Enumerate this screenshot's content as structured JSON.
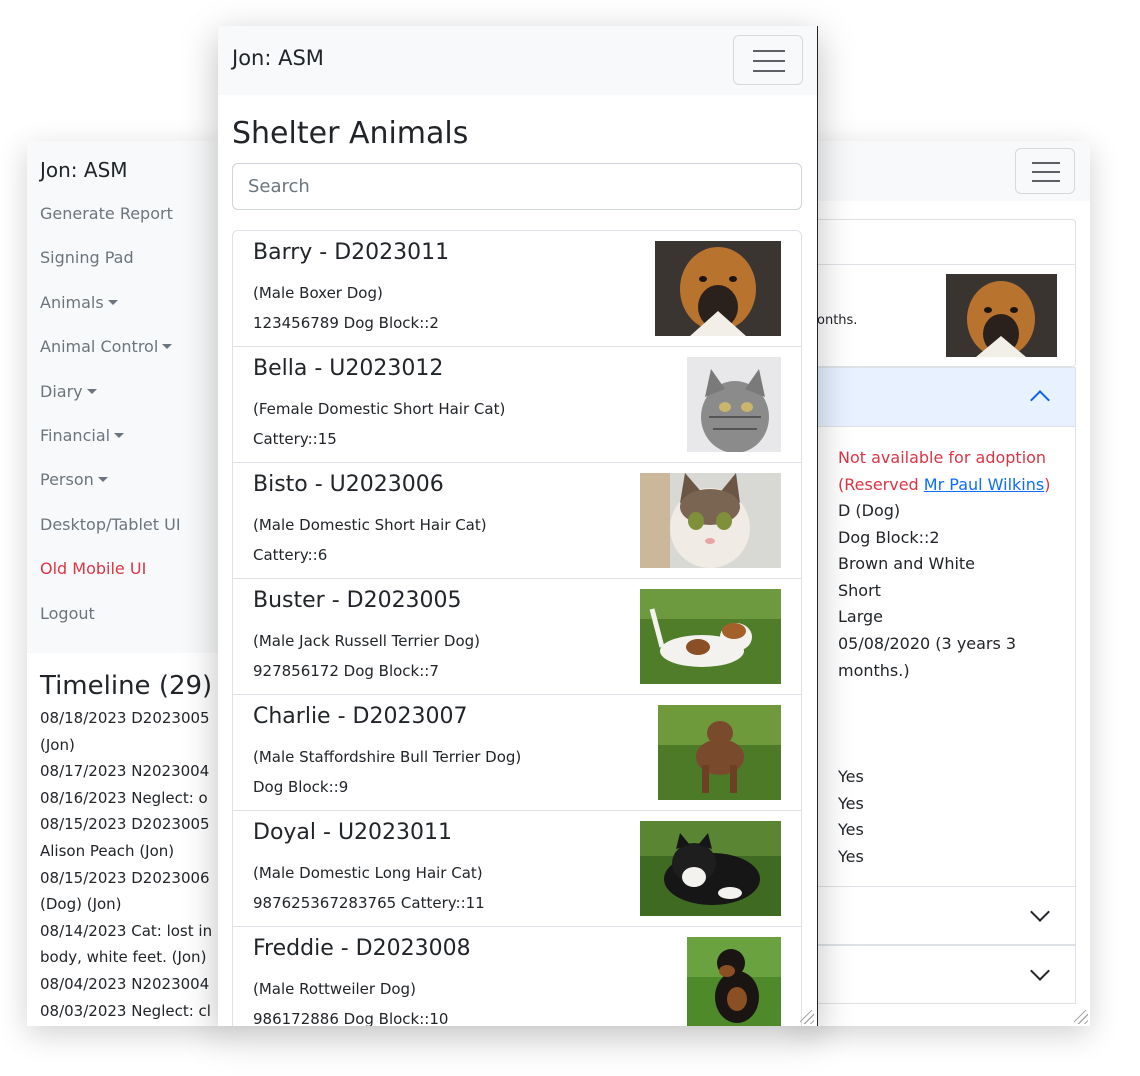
{
  "left_window": {
    "brand": "Jon: ASM",
    "menu": [
      {
        "label": "Generate Report",
        "dropdown": false,
        "red": false
      },
      {
        "label": "Signing Pad",
        "dropdown": false,
        "red": false
      },
      {
        "label": "Animals",
        "dropdown": true,
        "red": false
      },
      {
        "label": "Animal Control",
        "dropdown": true,
        "red": false
      },
      {
        "label": "Diary",
        "dropdown": true,
        "red": false
      },
      {
        "label": "Financial",
        "dropdown": true,
        "red": false
      },
      {
        "label": "Person",
        "dropdown": true,
        "red": false
      },
      {
        "label": "Desktop/Tablet UI",
        "dropdown": false,
        "red": false
      },
      {
        "label": "Old Mobile UI",
        "dropdown": false,
        "red": true
      },
      {
        "label": "Logout",
        "dropdown": false,
        "red": false
      }
    ],
    "timeline_title": "Timeline (29)",
    "timeline_lines": [
      "08/18/2023 D2023005",
      "(Jon)",
      "08/17/2023 N2023004",
      "08/16/2023 Neglect: o",
      "08/15/2023 D2023005",
      "Alison Peach (Jon)",
      "08/15/2023 D2023006",
      "(Dog) (Jon)",
      "08/14/2023 Cat: lost in",
      "body, white feet. (Jon)",
      "08/04/2023 N2023004",
      "08/03/2023 Neglect: cl"
    ]
  },
  "right_window": {
    "months_snippet": "onths.",
    "not_available": "Not available for adoption",
    "reserved_prefix": "(Reserved ",
    "reserved_person": "Mr Paul Wilkins",
    "reserved_suffix": ")",
    "details": [
      "D (Dog)",
      "Dog Block::2",
      "Brown and White",
      "Short",
      "Large",
      "05/08/2020 (3 years 3",
      "months.)"
    ],
    "flags": [
      "Yes",
      "Yes",
      "Yes",
      "Yes"
    ]
  },
  "front_window": {
    "brand": "Jon: ASM",
    "page_title": "Shelter Animals",
    "search_placeholder": "Search",
    "animals": [
      {
        "name": "Barry - D2023011",
        "desc": "(Male Boxer Dog)",
        "loc": "123456789 Dog Block::2",
        "photo": "boxer-dog-photo"
      },
      {
        "name": "Bella - U2023012",
        "desc": "(Female Domestic Short Hair Cat)",
        "loc": "Cattery::15",
        "photo": "tabby-cat-photo"
      },
      {
        "name": "Bisto - U2023006",
        "desc": "(Male Domestic Short Hair Cat)",
        "loc": "Cattery::6",
        "photo": "kitten-photo"
      },
      {
        "name": "Buster - D2023005",
        "desc": "(Male Jack Russell Terrier Dog)",
        "loc": "927856172 Dog Block::7",
        "photo": "jack-russell-photo"
      },
      {
        "name": "Charlie - D2023007",
        "desc": "(Male Staffordshire Bull Terrier Dog)",
        "loc": "Dog Block::9",
        "photo": "staffy-photo"
      },
      {
        "name": "Doyal - U2023011",
        "desc": "(Male Domestic Long Hair Cat)",
        "loc": "987625367283765 Cattery::11",
        "photo": "longhair-cat-photo"
      },
      {
        "name": "Freddie - D2023008",
        "desc": "(Male Rottweiler Dog)",
        "loc": "986172886 Dog Block::10",
        "photo": "rottweiler-photo"
      }
    ]
  }
}
